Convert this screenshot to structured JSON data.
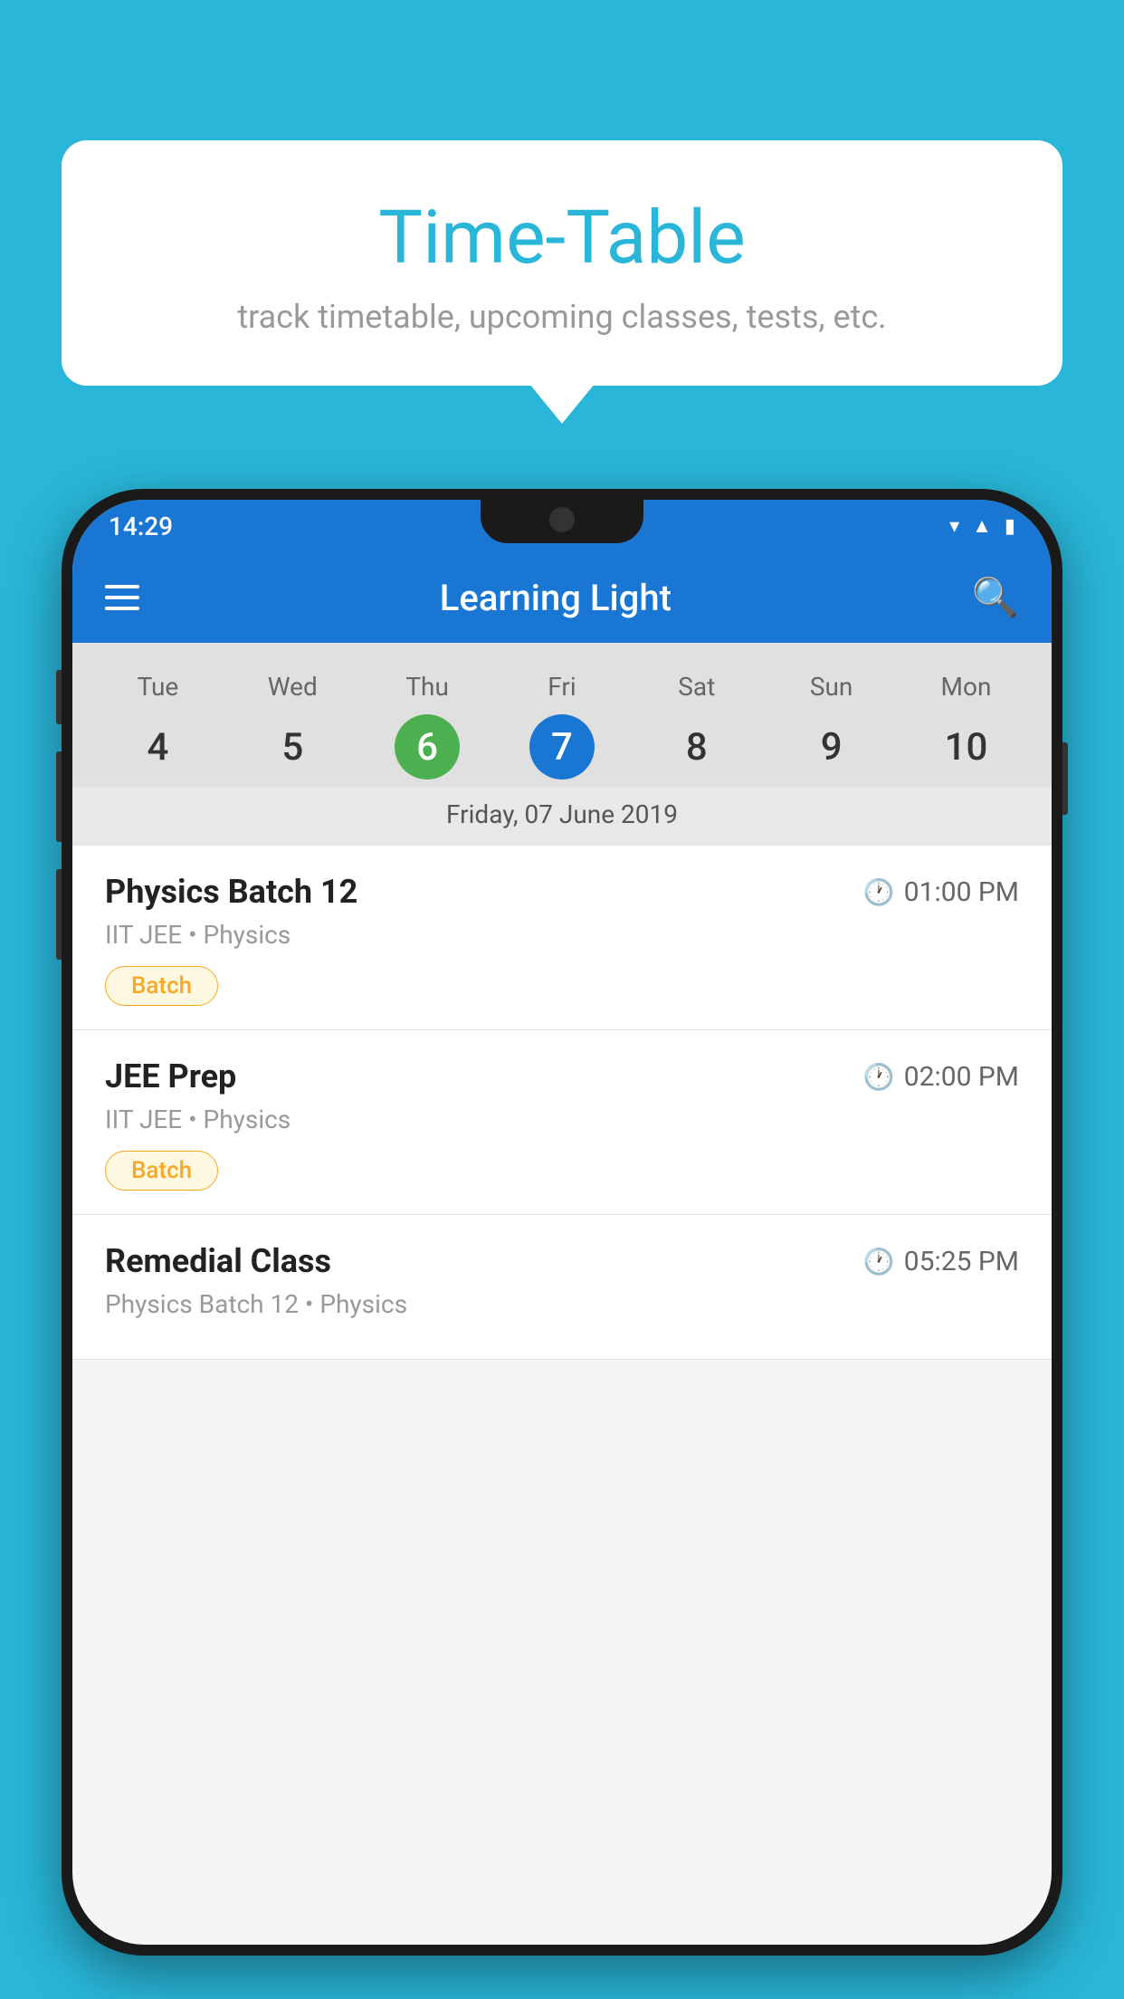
{
  "background_color": "#29b6d8",
  "tooltip": {
    "title": "Time-Table",
    "subtitle": "track timetable, upcoming classes, tests, etc."
  },
  "app": {
    "status_time": "14:29",
    "title": "Learning Light"
  },
  "calendar": {
    "days": [
      {
        "name": "Tue",
        "num": "4",
        "state": "normal"
      },
      {
        "name": "Wed",
        "num": "5",
        "state": "normal"
      },
      {
        "name": "Thu",
        "num": "6",
        "state": "today"
      },
      {
        "name": "Fri",
        "num": "7",
        "state": "selected"
      },
      {
        "name": "Sat",
        "num": "8",
        "state": "normal"
      },
      {
        "name": "Sun",
        "num": "9",
        "state": "normal"
      },
      {
        "name": "Mon",
        "num": "10",
        "state": "normal"
      }
    ],
    "selected_date_label": "Friday, 07 June 2019"
  },
  "schedule": [
    {
      "title": "Physics Batch 12",
      "time": "01:00 PM",
      "sub": "IIT JEE • Physics",
      "badge": "Batch"
    },
    {
      "title": "JEE Prep",
      "time": "02:00 PM",
      "sub": "IIT JEE • Physics",
      "badge": "Batch"
    },
    {
      "title": "Remedial Class",
      "time": "05:25 PM",
      "sub": "Physics Batch 12 • Physics",
      "badge": ""
    }
  ],
  "labels": {
    "batch": "Batch"
  }
}
